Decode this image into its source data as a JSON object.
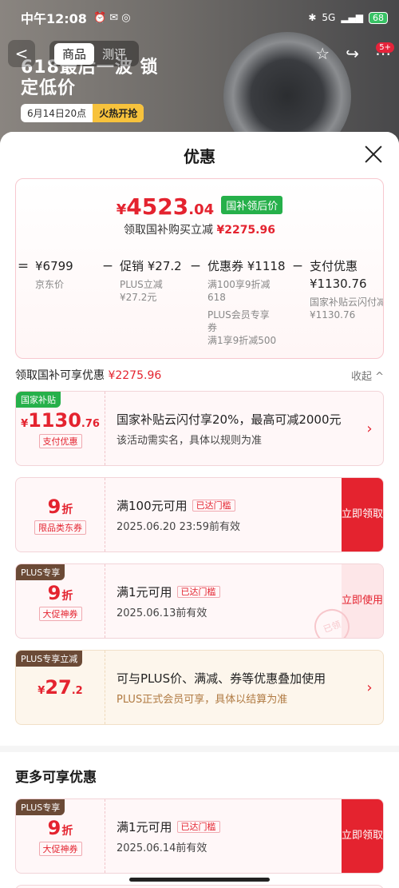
{
  "status_bar": {
    "time": "中午12:08",
    "network": "5G",
    "battery": "68"
  },
  "nav": {
    "back": "<",
    "tabs": [
      "商品",
      "测评"
    ],
    "more_badge": "5+"
  },
  "banner": {
    "headline": "618最后一波 锁定低价",
    "date": "6月14日20点",
    "cta": "火热开抢"
  },
  "sheet": {
    "title": "优惠",
    "price": {
      "currency": "¥",
      "int": "4523",
      "dec": ".04",
      "tag": "国补领后价",
      "sub_label": "领取国补购买立减",
      "sub_amount": "¥2275.96"
    },
    "breakdown": [
      {
        "op": "=",
        "head": "¥6799",
        "lines": [
          "京东价"
        ]
      },
      {
        "op": "−",
        "head": "促销 ¥27.2",
        "lines": [
          "PLUS立减",
          "¥27.2元"
        ]
      },
      {
        "op": "−",
        "head": "优惠券 ¥1118",
        "lines": [
          "满100享9折减",
          "618",
          "PLUS会员专享",
          "券",
          "满1享9折减500"
        ]
      },
      {
        "op": "−",
        "head": "支付优惠 ¥1130.76",
        "lines": [
          "国家补贴云闪付减",
          "¥1130.76"
        ]
      }
    ],
    "section": {
      "label": "领取国补可享优惠",
      "amount": "¥2275.96",
      "collapse": "收起 ^"
    },
    "cards": [
      {
        "corner": "国家补贴",
        "cur": "¥",
        "int": "1130",
        "dec": ".76",
        "sub": "支付优惠",
        "t1": "国家补贴云闪付享20%，最高可减2000元",
        "t2": "该活动需实名，具体以规则为准",
        "arrow": "›"
      },
      {
        "int": "9",
        "zhe": "折",
        "sub": "限品类东券",
        "t1": "满100元可用",
        "pill": "已达门槛",
        "t2": "2025.06.20 23:59前有效",
        "action": "立即领取"
      },
      {
        "corner": "PLUS专享",
        "int": "9",
        "zhe": "折",
        "sub": "大促神券",
        "t1": "满1元可用",
        "pill": "已达门槛",
        "t2": "2025.06.13前有效",
        "action": "立即使用",
        "stamp": "已领"
      },
      {
        "corner": "PLUS专享立减",
        "cur": "¥",
        "int": "27",
        "dec": ".2",
        "t1": "可与PLUS价、满减、券等优惠叠加使用",
        "t2": "PLUS正式会员可享，具体以结算为准",
        "arrow": "›"
      }
    ],
    "more": {
      "title": "更多可享优惠",
      "card": {
        "corner": "PLUS专享",
        "int": "9",
        "zhe": "折",
        "sub": "大促神券",
        "t1": "满1元可用",
        "pill": "已达门槛",
        "t2": "2025.06.14前有效",
        "action": "立即领取"
      }
    }
  },
  "colors": {
    "accent": "#e4232f",
    "green": "#26b04a",
    "brown": "#6b4a36"
  }
}
